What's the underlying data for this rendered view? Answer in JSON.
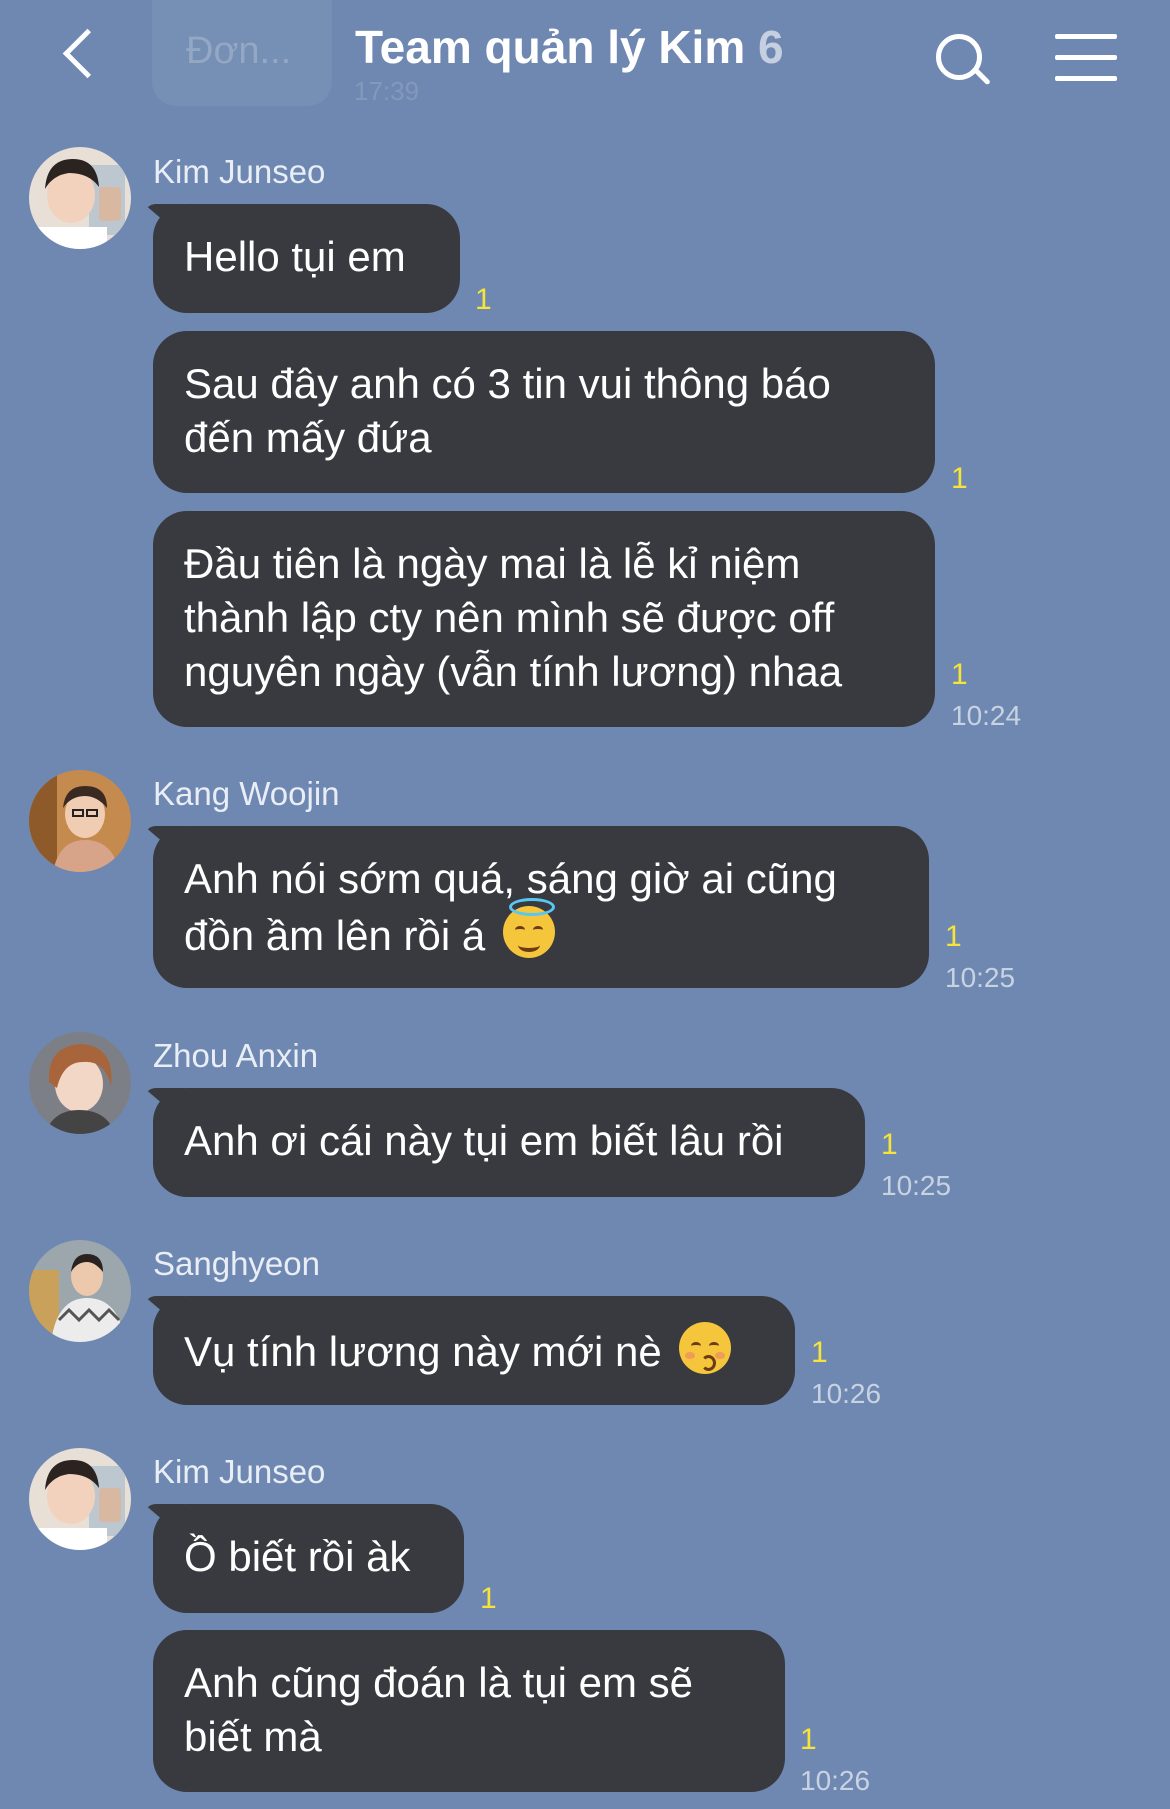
{
  "header": {
    "prev_preview": "Đơn...",
    "prev_time": "17:39",
    "title": "Team quản lý Kim",
    "member_count": "6"
  },
  "groups": [
    {
      "sender": "Kim Junseo",
      "avatar": "avatar-kim-junseo",
      "messages": [
        {
          "lines": [
            "Hello tụi em"
          ],
          "unread": "1"
        },
        {
          "lines": [
            "Sau đây anh có 3 tin vui thông báo",
            "đến mấy đứa"
          ],
          "unread": "1"
        },
        {
          "lines": [
            "Đầu tiên là ngày mai là lễ kỉ niệm",
            "thành lập cty nên mình sẽ được off",
            "nguyên ngày (vẫn tính lương) nhaa"
          ],
          "unread": "1",
          "time": "10:24"
        }
      ]
    },
    {
      "sender": "Kang Woojin",
      "avatar": "avatar-kang-woojin",
      "messages": [
        {
          "lines": [
            "Anh nói sớm quá, sáng giờ ai cũng",
            "đồn ầm lên rồi á"
          ],
          "emoji": "smiling-face-with-halo",
          "unread": "1",
          "time": "10:25"
        }
      ]
    },
    {
      "sender": "Zhou Anxin",
      "avatar": "avatar-zhou-anxin",
      "messages": [
        {
          "lines": [
            "Anh ơi cái này tụi em biết lâu rồi"
          ],
          "unread": "1",
          "time": "10:25"
        }
      ]
    },
    {
      "sender": "Sanghyeon",
      "avatar": "avatar-sanghyeon",
      "messages": [
        {
          "lines": [
            "Vụ tính lương này mới nè"
          ],
          "emoji": "kissing-face",
          "unread": "1",
          "time": "10:26"
        }
      ]
    },
    {
      "sender": "Kim Junseo",
      "avatar": "avatar-kim-junseo",
      "messages": [
        {
          "lines": [
            "Ồ biết rồi àk"
          ],
          "unread": "1"
        },
        {
          "lines": [
            "Anh cũng đoán là tụi em sẽ",
            "biết mà"
          ],
          "unread": "1",
          "time": "10:26"
        }
      ]
    }
  ],
  "colors": {
    "background": "#6e88b1",
    "bubble": "#393a3f",
    "unread": "#f7e43a"
  }
}
